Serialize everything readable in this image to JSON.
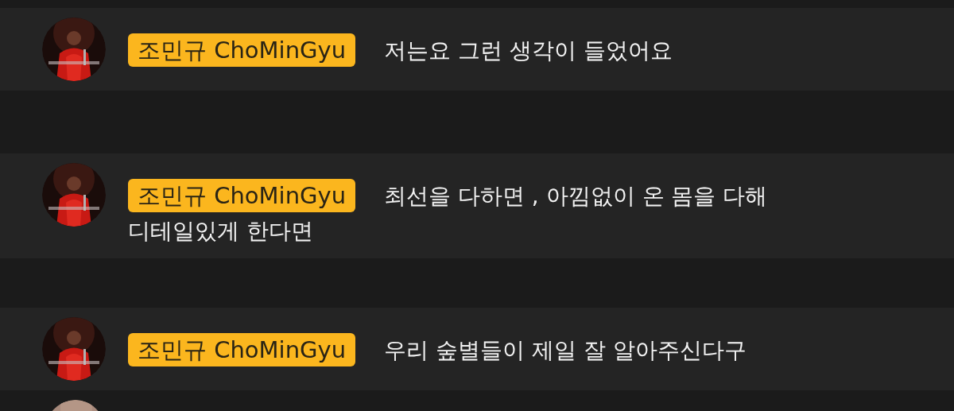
{
  "messages": [
    {
      "kind": "message",
      "author": "조민규 ChoMinGyu",
      "lines": [
        "저는요 그런 생각이 들었어요"
      ]
    },
    {
      "kind": "message",
      "author": "조민규 ChoMinGyu",
      "lines": [
        "최선을 다하면 , 아낌없이 온 몸을 다해",
        "디테일있게 한다면"
      ]
    },
    {
      "kind": "message",
      "author": "조민규 ChoMinGyu",
      "lines": [
        "우리 숲별들이 제일 잘 알아주신다구"
      ]
    },
    {
      "kind": "avatar_only"
    }
  ]
}
